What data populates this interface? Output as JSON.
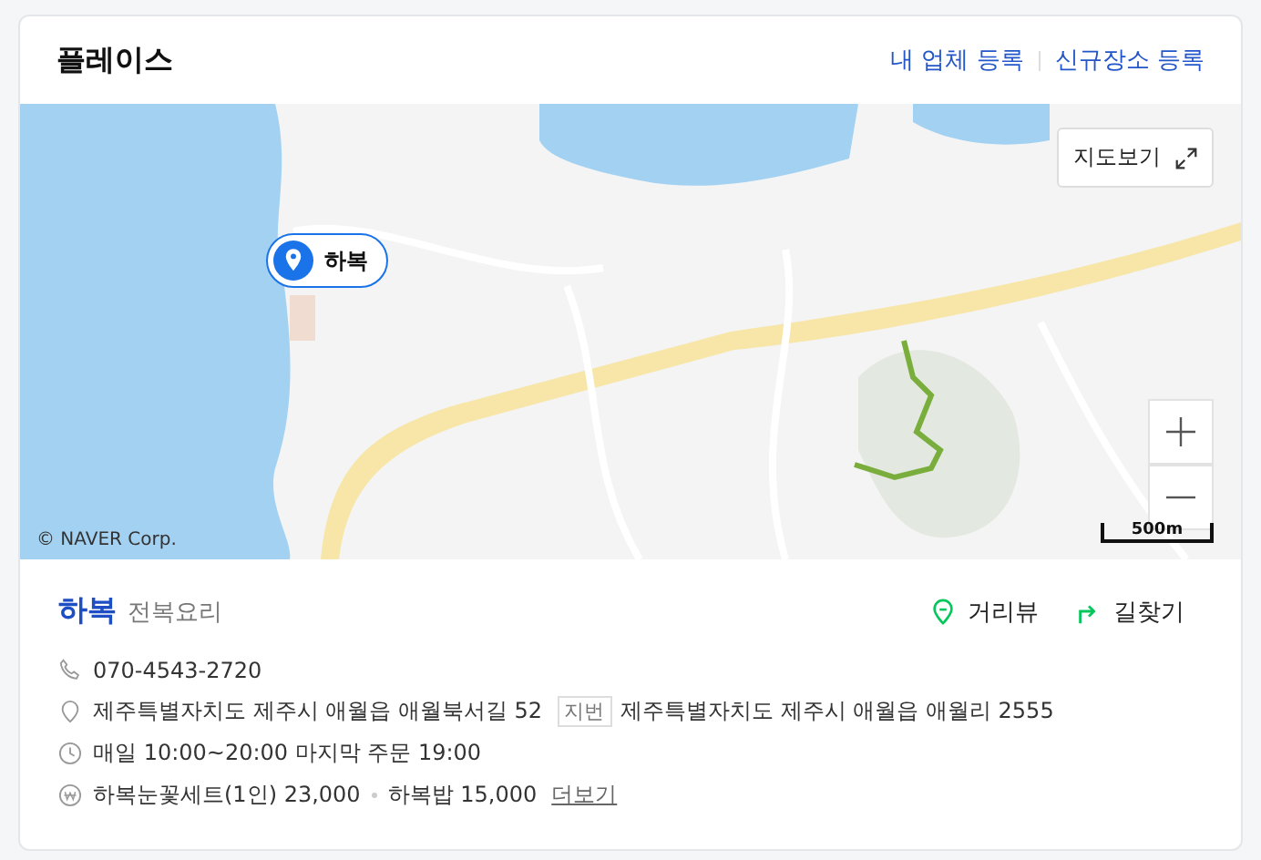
{
  "header": {
    "title": "플레이스",
    "links": [
      "내 업체 등록",
      "신규장소 등록"
    ]
  },
  "map": {
    "kind": "picture",
    "marker": "하복",
    "view_button": "지도보기",
    "scale": "500m",
    "copyright": "© NAVER Corp."
  },
  "place": {
    "name": "하복",
    "category": "전복요리",
    "actions": [
      {
        "kind": "street",
        "label": "거리뷰"
      },
      {
        "kind": "route",
        "label": "길찾기"
      }
    ],
    "details": [
      {
        "kind": "phone",
        "text": "070-4543-2720"
      },
      {
        "kind": "address",
        "text": "제주특별자치도 제주시 애월읍 애월북서길 52",
        "badge": "지번",
        "text2": "제주특별자치도 제주시 애월읍 애월리 2555"
      },
      {
        "kind": "hours",
        "text": "매일 10:00~20:00 마지막 주문 19:00"
      },
      {
        "kind": "menu",
        "items": [
          "하복눈꽃세트(1인) 23,000",
          "하복밥 15,000"
        ],
        "more": "더보기"
      }
    ]
  }
}
